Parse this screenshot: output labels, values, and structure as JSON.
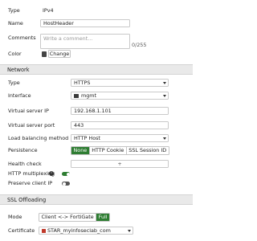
{
  "top": {
    "type_label": "Type",
    "type_value": "IPv4",
    "name_label": "Name",
    "name_value": "HostHeader",
    "comments_label": "Comments",
    "comments_placeholder": "Write a comment...",
    "comments_counter": "0/255",
    "color_label": "Color",
    "color_button": "Change",
    "color_swatch": "#444444"
  },
  "network": {
    "title": "Network",
    "type_label": "Type",
    "type_value": "HTTPS",
    "interface_label": "Interface",
    "interface_value": "mgmt",
    "vip_label": "Virtual server IP",
    "vip_value": "192.168.1.101",
    "vport_label": "Virtual server port",
    "vport_value": "443",
    "lb_label": "Load balancing method",
    "lb_value": "HTTP Host",
    "persistence_label": "Persistence",
    "persistence_options": [
      "None",
      "HTTP Cookie",
      "SSL Session ID"
    ],
    "persistence_selected": "None",
    "health_label": "Health check",
    "health_add": "+",
    "multiplex_label": "HTTP multiplexing",
    "multiplex_on": true,
    "preserve_label": "Preserve client IP",
    "preserve_on": false
  },
  "ssl": {
    "title": "SSL Offloading",
    "mode_label": "Mode",
    "mode_options": [
      "Client <-> FortiGate",
      "Full"
    ],
    "mode_selected": "Full",
    "cert_label": "Certificate",
    "cert_value": "STAR_myinfoseclab_com"
  },
  "colors": {
    "accent": "#2e7d32",
    "toggle_off": "#555555"
  }
}
